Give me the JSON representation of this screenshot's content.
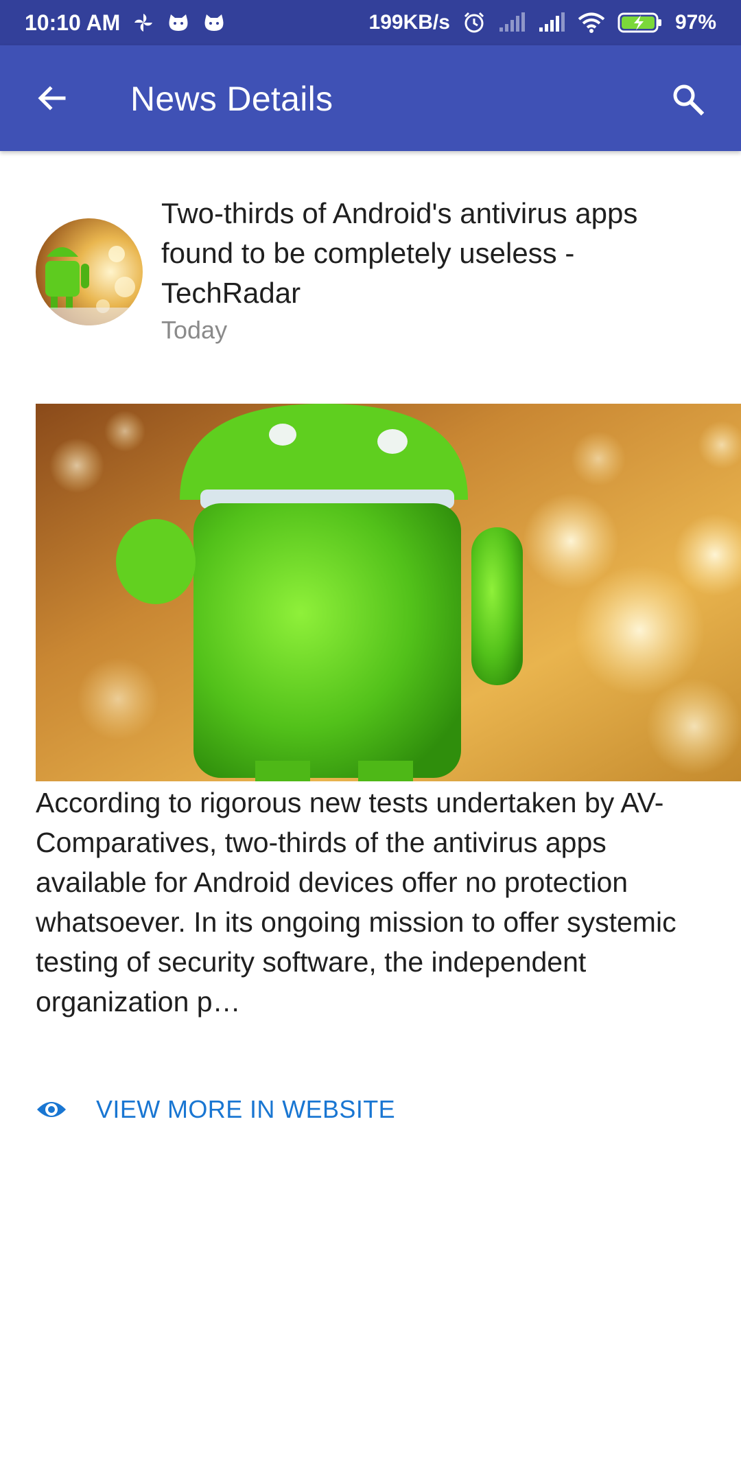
{
  "status_bar": {
    "time": "10:10 AM",
    "speed": "199KB/s",
    "battery_percent": "97%",
    "battery_level": 0.97,
    "icons_left": [
      "pinwheel-icon",
      "cat-icon",
      "cat-icon"
    ],
    "icons_right": [
      "alarm-icon",
      "signal-icon",
      "signal-icon",
      "wifi-icon",
      "battery-charging-icon"
    ]
  },
  "app_bar": {
    "title": "News Details",
    "back_icon": "arrow-back-icon",
    "search_icon": "search-icon",
    "background_color": "#3f51b5"
  },
  "article": {
    "headline": "Two-thirds of Android's antivirus apps found to be completely useless - TechRadar",
    "date": "Today",
    "avatar_icon": "android-figure-thumbnail",
    "image": "android-figure-photo",
    "body": "According to rigorous new tests undertaken by AV-Comparatives, two-thirds of the antivirus apps available for Android devices offer no protection whatsoever. In its ongoing mission to offer systemic testing of security software, the independent organization p…"
  },
  "actions": {
    "view_more_label": "VIEW MORE IN WEBSITE",
    "view_more_icon": "eye-icon",
    "accent_color": "#1976d2"
  }
}
